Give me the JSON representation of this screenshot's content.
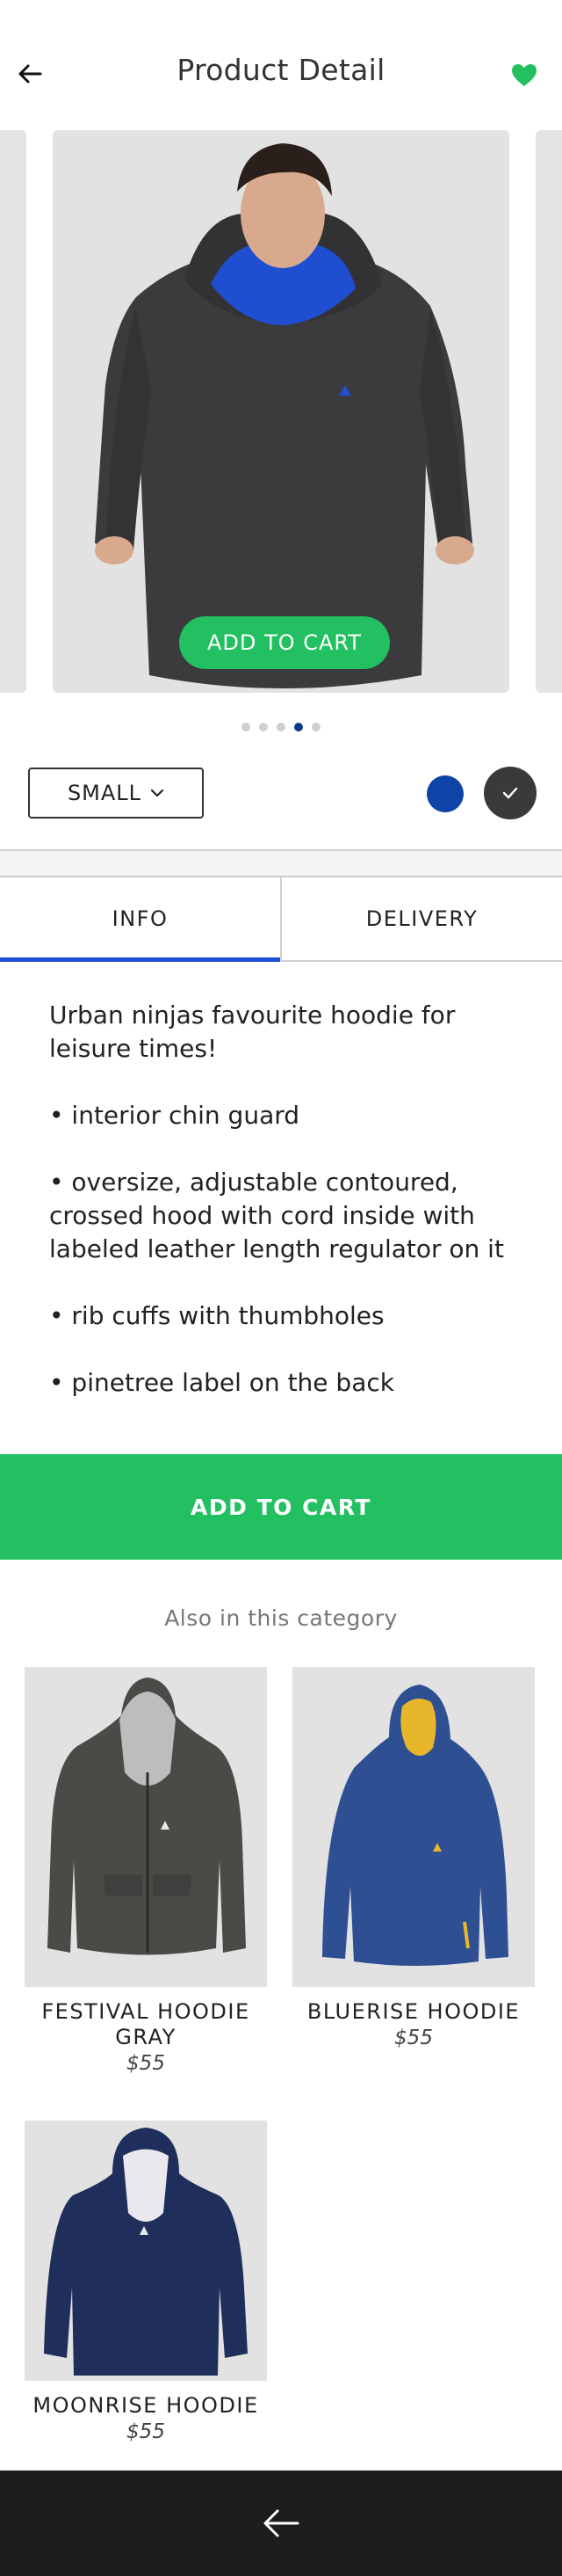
{
  "header": {
    "title": "Product Detail",
    "back_icon": "arrow-left-icon",
    "favorite_icon": "heart-icon",
    "favorite_color": "#22c061"
  },
  "carousel": {
    "cta_label": "ADD TO CART",
    "slide_count": 5,
    "active_slide": 4,
    "cta_color": "#22c061"
  },
  "options": {
    "size_value": "SMALL",
    "size_icon": "chevron-down-icon",
    "colors": [
      {
        "name": "blue",
        "hex": "#0e44a8",
        "selected": false
      },
      {
        "name": "dark-gray",
        "hex": "#3a3a3a",
        "selected": true
      }
    ]
  },
  "tabs": {
    "items": [
      {
        "label": "INFO",
        "active": true
      },
      {
        "label": "DELIVERY",
        "active": false
      }
    ],
    "active_color": "#1b4fd8"
  },
  "description": {
    "paragraphs": [
      "Urban ninjas favourite hoodie for leisure times!",
      "• interior chin guard",
      "• oversize, adjustable contoured, crossed hood with cord inside with labeled leather length regulator on it",
      "• rib cuffs with thumbholes",
      "• pinetree label on the back"
    ]
  },
  "cart_button": {
    "label": "ADD TO CART"
  },
  "related": {
    "heading": "Also in this category",
    "products": [
      {
        "name": "FESTIVAL HOODIE GRAY",
        "price": "$55"
      },
      {
        "name": "BLUERISE HOODIE",
        "price": "$55"
      },
      {
        "name": "MOONRISE HOODIE",
        "price": "$55"
      }
    ]
  },
  "bottom_bar": {
    "back_icon": "arrow-left-icon"
  }
}
